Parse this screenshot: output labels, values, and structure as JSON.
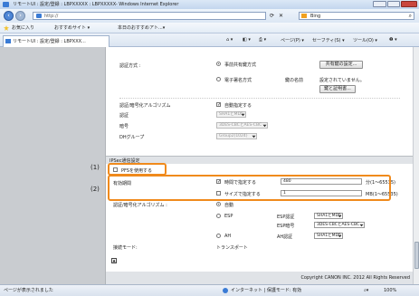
{
  "window": {
    "title": "リモートUI : 設定/登録 : LBPXXXXX : LBPXXXXX- Windows Internet Explorer"
  },
  "address": {
    "url": "http://",
    "search_engine": "Bing"
  },
  "favorites": {
    "label": "お気に入り",
    "item1": "おすすめサイト ▾",
    "item2": "本日のおすすめアト...▾"
  },
  "tab": {
    "title": "リモートUI : 設定/登録 : LBPXXX..."
  },
  "commands": {
    "page": "ページ(P) ▾",
    "safety": "セーフティ(S) ▾",
    "tools": "ツール(O) ▾",
    "help": "❷ ▾"
  },
  "auth": {
    "method_label": "認証方式 :",
    "shared_key_option": "事前共有鍵方式",
    "shared_key_button": "共有鍵の設定...",
    "digital_sig_option": "電子署名方式",
    "key_name_label": "鍵の名前",
    "key_status": "設定されていません。",
    "key_register_button": "鍵と証明書..."
  },
  "algo": {
    "title": "認証/暗号化アルゴリズム",
    "auto_label": "自動指定する",
    "auth_label": "認証",
    "auth_value": "SHA1とMD5",
    "enc_label": "暗号",
    "enc_value": "3DES-CBCとAES-CBC",
    "dh_label": "DHグループ",
    "dh_value": "Group2(1024)"
  },
  "ipsec": {
    "section_title": "IPSec通信設定",
    "pfs_label": "PFSを使用する",
    "lifetime_label": "有効期間",
    "time_label": "時間で指定する",
    "time_value": "480",
    "time_unit": "分(1〜65535)",
    "size_label": "サイズで指定する",
    "size_value": "1",
    "size_unit": "MB(1〜65535)",
    "algo_label": "認証/暗号化アルゴリズム :",
    "auto_option": "自動",
    "esp_option": "ESP",
    "esp_auth_label": "ESP認証",
    "esp_auth_value": "SHA1とMD5",
    "esp_enc_label": "ESP暗号",
    "esp_enc_value": "3DES-CBCとAES-CBC",
    "ah_option": "AH",
    "ah_auth_label": "AH認証",
    "ah_auth_value": "SHA1とMD5",
    "conn_mode_label": "接続モード:",
    "conn_mode_value": "トランスポート"
  },
  "copyright": "Copyright CANON INC. 2012 All Rights Reserved",
  "callouts": {
    "one": "(1)",
    "two": "(2)"
  },
  "status": {
    "left": "ページが表示されました",
    "zone": "インターネット | 保護モード: 有効",
    "zoom": "100%"
  },
  "colors": {
    "highlight": "#f08a1c",
    "ie_blue": "#4d86d6"
  }
}
